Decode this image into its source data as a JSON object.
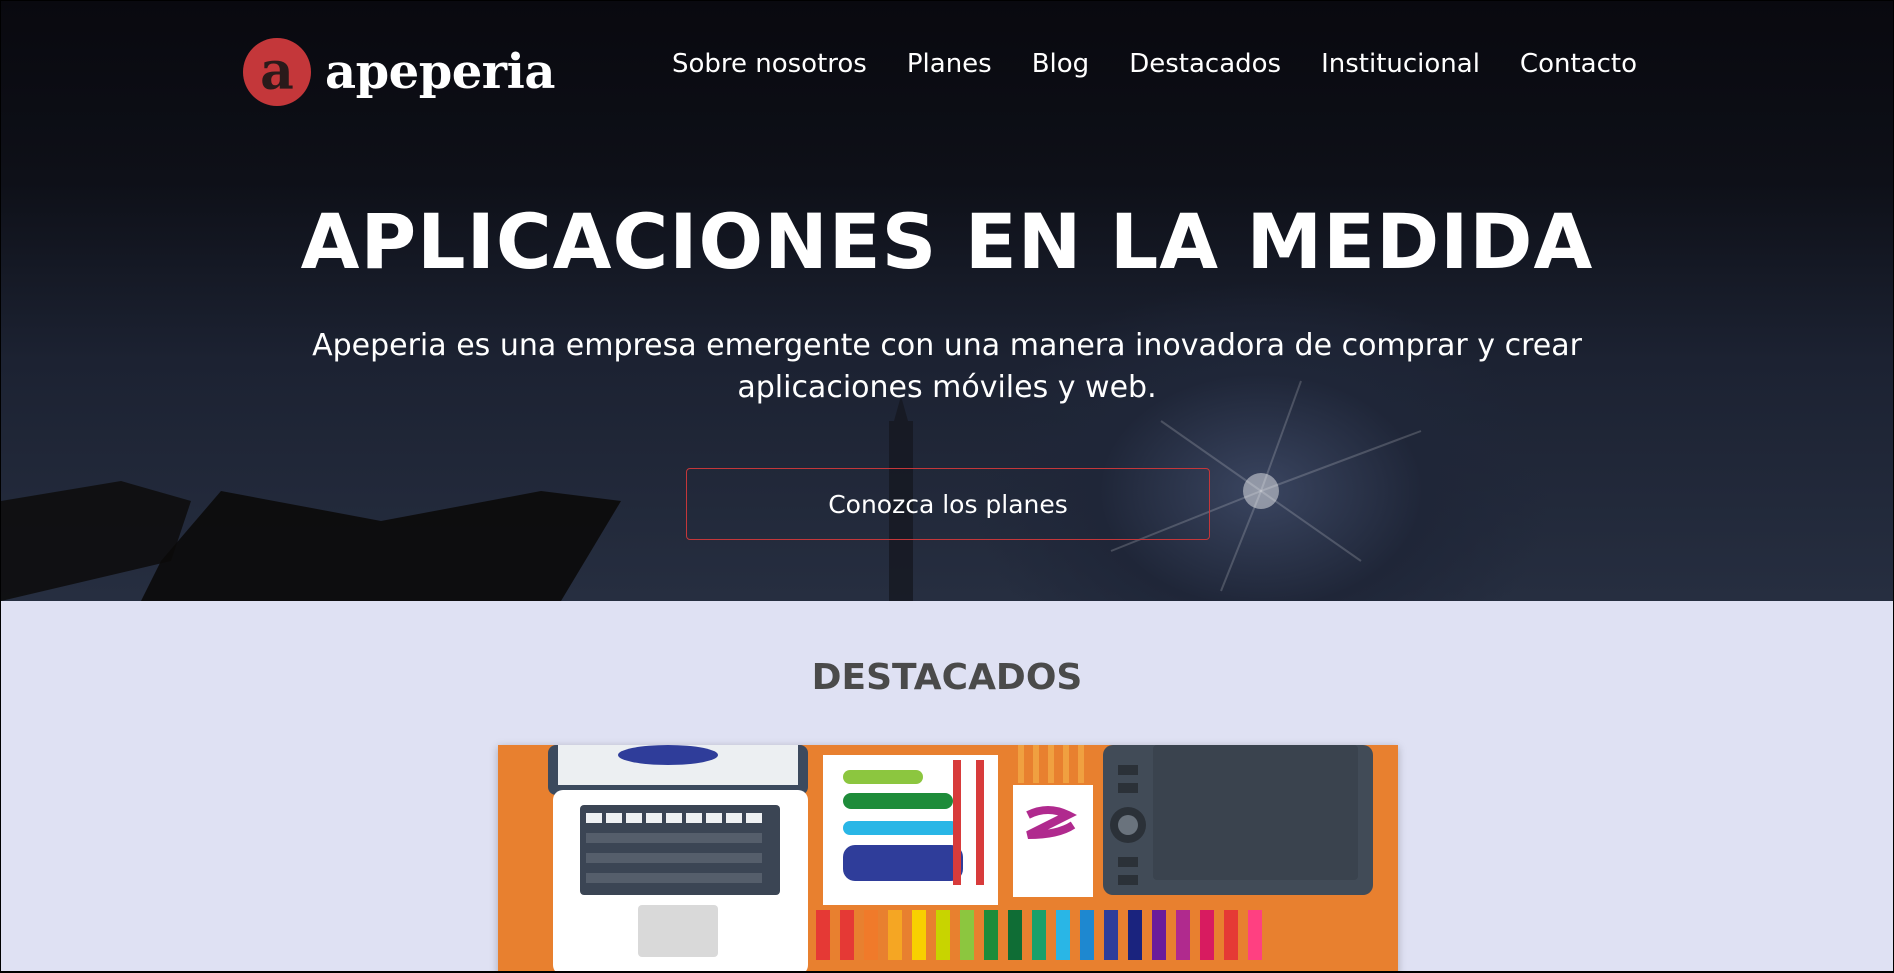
{
  "brand": {
    "logo_letter": "a",
    "name": "apeperia",
    "accent": "#c4373a"
  },
  "nav": {
    "items": [
      {
        "label": "Sobre nosotros"
      },
      {
        "label": "Planes"
      },
      {
        "label": "Blog"
      },
      {
        "label": "Destacados"
      },
      {
        "label": "Institucional"
      },
      {
        "label": "Contacto"
      }
    ]
  },
  "hero": {
    "title": "APLICACIONES EN LA MEDIDA",
    "subtitle": "Apeperia es una empresa emergente con una manera inovadora de comprar y crear aplicaciones móviles y web.",
    "cta_label": "Conozca los planes"
  },
  "featured": {
    "title": "DESTACADOS",
    "image_icon": "art-supplies-illustration-icon",
    "background_color": "#e8802f"
  }
}
